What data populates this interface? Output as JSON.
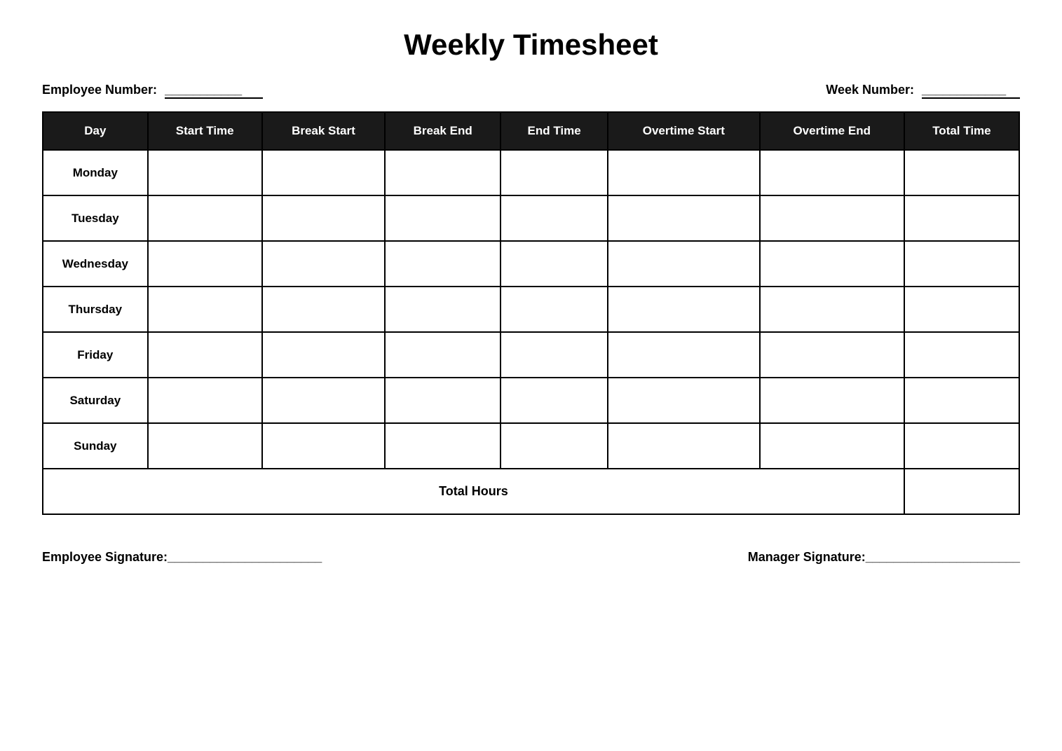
{
  "title": "Weekly Timesheet",
  "employee_number_label": "Employee Number:",
  "employee_number_value": "___________",
  "week_number_label": "Week Number:",
  "week_number_value": "____________",
  "table": {
    "headers": [
      "Day",
      "Start Time",
      "Break Start",
      "Break End",
      "End Time",
      "Overtime Start",
      "Overtime End",
      "Total Time"
    ],
    "rows": [
      {
        "day": "Monday"
      },
      {
        "day": "Tuesday"
      },
      {
        "day": "Wednesday"
      },
      {
        "day": "Thursday"
      },
      {
        "day": "Friday"
      },
      {
        "day": "Saturday"
      },
      {
        "day": "Sunday"
      }
    ],
    "total_hours_label": "Total Hours"
  },
  "employee_signature_label": "Employee Signature:______________________",
  "manager_signature_label": "Manager Signature:______________________"
}
